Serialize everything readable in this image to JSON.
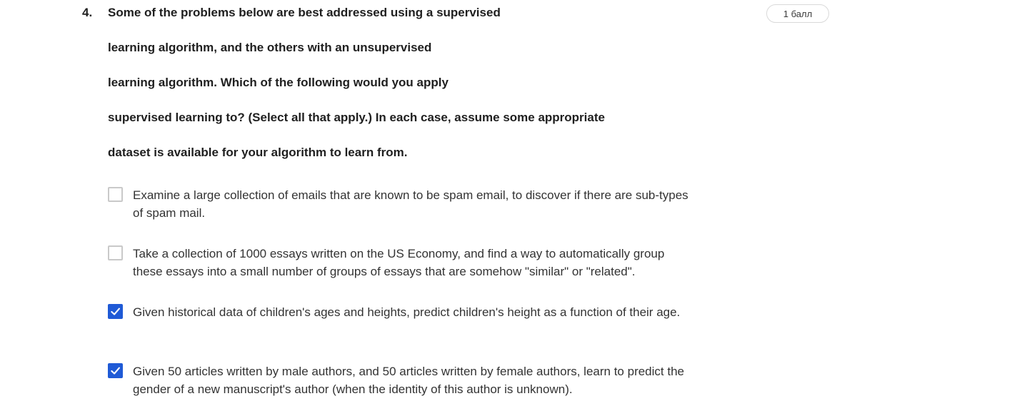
{
  "question": {
    "number": "4.",
    "points": "1 балл",
    "prompt_lines": [
      "Some of the problems below are best addressed using a supervised",
      "learning algorithm, and the others with an unsupervised",
      "learning algorithm. Which of the following would you apply",
      "supervised learning to? (Select all that apply.) In each case, assume some appropriate",
      "dataset is available for your algorithm to learn from."
    ],
    "options": [
      {
        "text": "Examine a large collection of emails that are known to be spam email, to discover if there are sub-types of spam mail.",
        "checked": false
      },
      {
        "text": "Take a collection of 1000 essays written on the US Economy, and find a way to automatically group these essays into a small number of groups of essays that are somehow \"similar\" or \"related\".",
        "checked": false
      },
      {
        "text": "Given historical data of children's ages and heights, predict children's height as a function of their age.",
        "checked": true
      },
      {
        "text": "Given 50 articles written by male authors, and 50 articles written by female authors, learn to predict the gender of a new manuscript's author (when the identity of this author is unknown).",
        "checked": true
      }
    ]
  },
  "colors": {
    "checkbox_checked": "#1f5ad6",
    "checkbox_border": "#c9c9c9",
    "text": "#1f1f1f"
  },
  "icons": {
    "check": "check-icon"
  }
}
